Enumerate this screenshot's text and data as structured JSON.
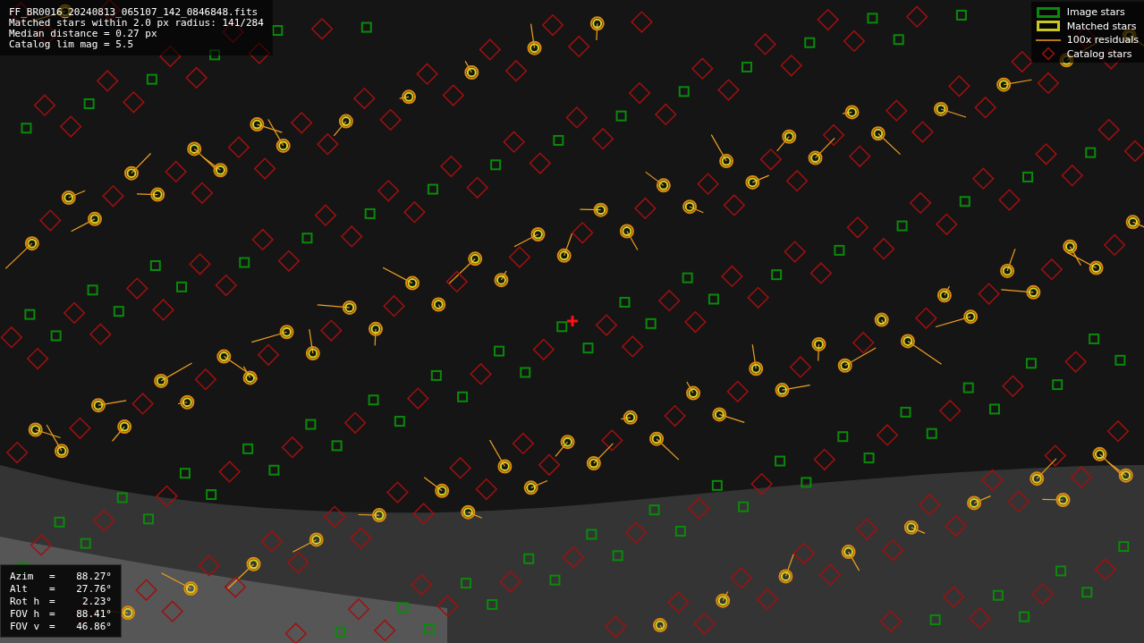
{
  "info": {
    "filename": "FF_BR0016_20240813_065107_142_0846848.fits",
    "lines": [
      "Matched stars within 2.0 px radius: 141/284",
      "Median distance = 0.27 px",
      "Catalog lim mag = 5.5"
    ]
  },
  "legend": [
    {
      "kind": "image",
      "label": "Image stars"
    },
    {
      "kind": "matched",
      "label": "Matched stars"
    },
    {
      "kind": "residual",
      "label": "100x residuals"
    },
    {
      "kind": "catalog",
      "label": "Catalog stars"
    }
  ],
  "pointing": [
    {
      "name": "Azim",
      "sign": "=",
      "value": "88.27°"
    },
    {
      "name": "Alt",
      "sign": "=",
      "value": "27.76°"
    },
    {
      "name": "Rot h",
      "sign": "=",
      "value": "2.23°"
    },
    {
      "name": "FOV h",
      "sign": "=",
      "value": "88.41°"
    },
    {
      "name": "FOV v",
      "sign": "=",
      "value": "46.86°"
    }
  ]
}
